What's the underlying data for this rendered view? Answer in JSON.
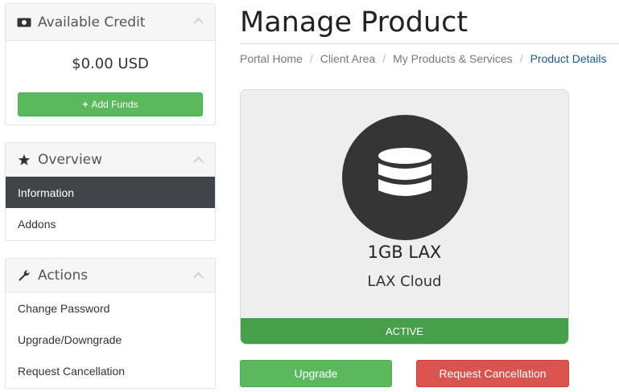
{
  "sidebar": {
    "credit": {
      "title": "Available Credit",
      "amount": "$0.00 USD",
      "add_funds_label": "Add Funds"
    },
    "overview": {
      "title": "Overview",
      "items": [
        {
          "label": "Information",
          "active": true
        },
        {
          "label": "Addons",
          "active": false
        }
      ]
    },
    "actions": {
      "title": "Actions",
      "items": [
        {
          "label": "Change Password"
        },
        {
          "label": "Upgrade/Downgrade"
        },
        {
          "label": "Request Cancellation"
        }
      ]
    }
  },
  "main": {
    "title": "Manage Product",
    "breadcrumb": [
      "Portal Home",
      "Client Area",
      "My Products & Services",
      "Product Details"
    ],
    "product": {
      "icon": "database-icon",
      "name": "1GB LAX",
      "group": "LAX Cloud",
      "status": "ACTIVE"
    },
    "buttons": {
      "upgrade": "Upgrade",
      "cancel": "Request Cancellation"
    }
  },
  "colors": {
    "success": "#5cb85c",
    "danger": "#d9534f",
    "active_menu": "#404547",
    "link": "#1a5b8a"
  }
}
